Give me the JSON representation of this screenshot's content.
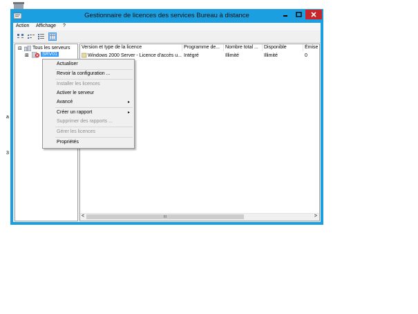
{
  "desktop": {
    "left_glyphs": [
      "a",
      "3"
    ]
  },
  "window": {
    "title": "Gestionnaire de licences des services Bureau à distance",
    "controls": {
      "minimize": "▬",
      "maximize": "☐",
      "close": "✕"
    }
  },
  "menubar": {
    "items": [
      "Action",
      "Affichage",
      "?"
    ]
  },
  "toolbar": {
    "buttons": [
      "large-icons-view",
      "small-icons-view",
      "list-view",
      "details-view"
    ],
    "active": "details-view"
  },
  "tree": {
    "root_label": "Tous les serveurs",
    "root_expander": "⊟",
    "child_label": "SRV01",
    "child_expander": "⊞"
  },
  "list": {
    "columns": [
      "Version et type de la licence",
      "Programme de...",
      "Nombre total ...",
      "Disponible",
      "Émise"
    ],
    "rows": [
      [
        "Windows 2000 Server - Licence d'accès u...",
        "Intégré",
        "Illimité",
        "Illimité",
        "0"
      ]
    ],
    "scroll_left": "<",
    "scroll_right": ">",
    "scroll_grip": "III"
  },
  "context_menu": {
    "items": [
      {
        "label": "Actualiser",
        "enabled": true
      },
      {
        "label": "Revoir la configuration ...",
        "enabled": true
      },
      {
        "label": "Installer les licences",
        "enabled": false
      },
      {
        "label": "Activer le serveur",
        "enabled": true
      },
      {
        "label": "Avancé",
        "enabled": true,
        "submenu": true
      },
      {
        "label": "Créer un rapport",
        "enabled": true,
        "submenu": true
      },
      {
        "label": "Supprimer des rapports ...",
        "enabled": false
      },
      {
        "label": "Gérer les licences",
        "enabled": false
      },
      {
        "label": "Propriétés",
        "enabled": true
      }
    ],
    "submenu_arrow": "▸"
  },
  "colors": {
    "window_frame": "#1b9fe0",
    "close_button": "#c7262b",
    "selection": "#3399ff"
  }
}
